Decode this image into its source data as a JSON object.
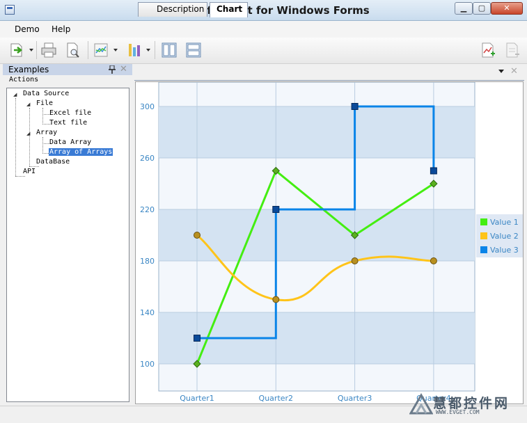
{
  "window": {
    "title": "RadarSoft Chart for Windows Forms",
    "controls": {
      "minimize": "▁",
      "maximize": "▢",
      "close": "✕"
    }
  },
  "menu": {
    "items": [
      "Demo",
      "Help"
    ]
  },
  "toolbar": {
    "icons": [
      "export-icon",
      "print-icon",
      "print-preview-icon",
      "chart-type-icon",
      "palette-icon",
      "layout-1-icon",
      "layout-2-icon",
      "add-chart-icon",
      "remove-chart-icon"
    ]
  },
  "left_panel": {
    "title": "Examples",
    "pin": "pin-icon",
    "close": "✕",
    "section_label": "Actions",
    "tree": [
      {
        "label": "Data Source",
        "expanded": true
      },
      {
        "label": "File",
        "expanded": true
      },
      {
        "label": "Excel file"
      },
      {
        "label": "Text file"
      },
      {
        "label": "Array",
        "expanded": true
      },
      {
        "label": "Data Array"
      },
      {
        "label": "Array of Arrays",
        "selected": true
      },
      {
        "label": "DataBase"
      },
      {
        "label": "API"
      }
    ]
  },
  "tabs": [
    {
      "label": "Description",
      "active": false
    },
    {
      "label": "Chart",
      "active": true
    }
  ],
  "tab_close": "✕",
  "watermark": {
    "text": "慧都控件网",
    "url": "WWW.EVGET.COM"
  },
  "colors": {
    "value1": "#44ee11",
    "value2": "#ffc41a",
    "value3": "#0a84e8",
    "band": "#d4e3f2",
    "axis_text": "#3a86c4"
  },
  "chart_data": {
    "type": "line",
    "categories": [
      "Quarter1",
      "Quarter2",
      "Quarter3",
      "Quarter4"
    ],
    "y_ticks": [
      100,
      140,
      180,
      220,
      260,
      300
    ],
    "ylim": [
      80,
      320
    ],
    "legend_position": "right",
    "series": [
      {
        "name": "Value 1",
        "values": [
          100,
          250,
          200,
          240
        ],
        "style": "straight",
        "marker": "diamond"
      },
      {
        "name": "Value 2",
        "values": [
          200,
          150,
          180,
          180
        ],
        "style": "smooth",
        "marker": "circle"
      },
      {
        "name": "Value 3",
        "values": [
          120,
          220,
          300,
          250
        ],
        "style": "step",
        "marker": "square"
      }
    ]
  }
}
